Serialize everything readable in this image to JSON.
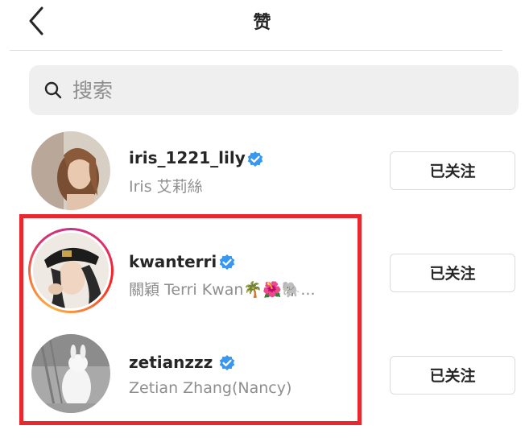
{
  "header": {
    "title": "赞",
    "back_icon": "chevron-left-icon"
  },
  "search": {
    "placeholder": "搜索",
    "icon": "search-icon"
  },
  "users": [
    {
      "username": "iris_1221_lily",
      "full_name": "Iris 艾莉絲",
      "verified": true,
      "follow_label": "已关注",
      "story_ring": false
    },
    {
      "username": "kwanterri",
      "full_name": "關穎 Terri Kwan🌴🌺🐘...",
      "verified": true,
      "follow_label": "已关注",
      "story_ring": true
    },
    {
      "username": "zetianzzz",
      "full_name": "Zetian Zhang(Nancy)",
      "verified": true,
      "follow_label": "已关注",
      "story_ring": false
    }
  ],
  "colors": {
    "verified_blue": "#3897f0",
    "highlight_red": "#e8272e",
    "secondary_text": "#8e8e8e"
  }
}
